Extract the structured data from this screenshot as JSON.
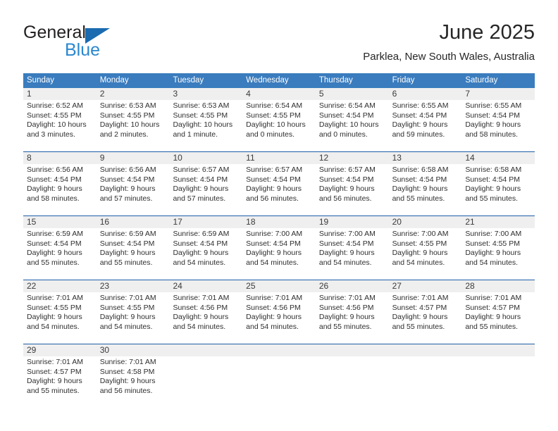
{
  "brand": {
    "name_primary": "General",
    "name_secondary": "Blue",
    "triangle_color": "#1a6bb0",
    "secondary_color": "#2a87d0"
  },
  "header": {
    "title": "June 2025",
    "subtitle": "Parklea, New South Wales, Australia"
  },
  "theme": {
    "header_row_bg": "#3a7cbe",
    "week_separator": "#1f5fa8",
    "daynum_band_bg": "#efefef",
    "text_color": "#2e2e2e"
  },
  "calendar": {
    "day_headers": [
      "Sunday",
      "Monday",
      "Tuesday",
      "Wednesday",
      "Thursday",
      "Friday",
      "Saturday"
    ],
    "weeks": [
      [
        {
          "day": "1",
          "lines": [
            "Sunrise: 6:52 AM",
            "Sunset: 4:55 PM",
            "Daylight: 10 hours",
            "and 3 minutes."
          ]
        },
        {
          "day": "2",
          "lines": [
            "Sunrise: 6:53 AM",
            "Sunset: 4:55 PM",
            "Daylight: 10 hours",
            "and 2 minutes."
          ]
        },
        {
          "day": "3",
          "lines": [
            "Sunrise: 6:53 AM",
            "Sunset: 4:55 PM",
            "Daylight: 10 hours",
            "and 1 minute."
          ]
        },
        {
          "day": "4",
          "lines": [
            "Sunrise: 6:54 AM",
            "Sunset: 4:55 PM",
            "Daylight: 10 hours",
            "and 0 minutes."
          ]
        },
        {
          "day": "5",
          "lines": [
            "Sunrise: 6:54 AM",
            "Sunset: 4:54 PM",
            "Daylight: 10 hours",
            "and 0 minutes."
          ]
        },
        {
          "day": "6",
          "lines": [
            "Sunrise: 6:55 AM",
            "Sunset: 4:54 PM",
            "Daylight: 9 hours",
            "and 59 minutes."
          ]
        },
        {
          "day": "7",
          "lines": [
            "Sunrise: 6:55 AM",
            "Sunset: 4:54 PM",
            "Daylight: 9 hours",
            "and 58 minutes."
          ]
        }
      ],
      [
        {
          "day": "8",
          "lines": [
            "Sunrise: 6:56 AM",
            "Sunset: 4:54 PM",
            "Daylight: 9 hours",
            "and 58 minutes."
          ]
        },
        {
          "day": "9",
          "lines": [
            "Sunrise: 6:56 AM",
            "Sunset: 4:54 PM",
            "Daylight: 9 hours",
            "and 57 minutes."
          ]
        },
        {
          "day": "10",
          "lines": [
            "Sunrise: 6:57 AM",
            "Sunset: 4:54 PM",
            "Daylight: 9 hours",
            "and 57 minutes."
          ]
        },
        {
          "day": "11",
          "lines": [
            "Sunrise: 6:57 AM",
            "Sunset: 4:54 PM",
            "Daylight: 9 hours",
            "and 56 minutes."
          ]
        },
        {
          "day": "12",
          "lines": [
            "Sunrise: 6:57 AM",
            "Sunset: 4:54 PM",
            "Daylight: 9 hours",
            "and 56 minutes."
          ]
        },
        {
          "day": "13",
          "lines": [
            "Sunrise: 6:58 AM",
            "Sunset: 4:54 PM",
            "Daylight: 9 hours",
            "and 55 minutes."
          ]
        },
        {
          "day": "14",
          "lines": [
            "Sunrise: 6:58 AM",
            "Sunset: 4:54 PM",
            "Daylight: 9 hours",
            "and 55 minutes."
          ]
        }
      ],
      [
        {
          "day": "15",
          "lines": [
            "Sunrise: 6:59 AM",
            "Sunset: 4:54 PM",
            "Daylight: 9 hours",
            "and 55 minutes."
          ]
        },
        {
          "day": "16",
          "lines": [
            "Sunrise: 6:59 AM",
            "Sunset: 4:54 PM",
            "Daylight: 9 hours",
            "and 55 minutes."
          ]
        },
        {
          "day": "17",
          "lines": [
            "Sunrise: 6:59 AM",
            "Sunset: 4:54 PM",
            "Daylight: 9 hours",
            "and 54 minutes."
          ]
        },
        {
          "day": "18",
          "lines": [
            "Sunrise: 7:00 AM",
            "Sunset: 4:54 PM",
            "Daylight: 9 hours",
            "and 54 minutes."
          ]
        },
        {
          "day": "19",
          "lines": [
            "Sunrise: 7:00 AM",
            "Sunset: 4:54 PM",
            "Daylight: 9 hours",
            "and 54 minutes."
          ]
        },
        {
          "day": "20",
          "lines": [
            "Sunrise: 7:00 AM",
            "Sunset: 4:55 PM",
            "Daylight: 9 hours",
            "and 54 minutes."
          ]
        },
        {
          "day": "21",
          "lines": [
            "Sunrise: 7:00 AM",
            "Sunset: 4:55 PM",
            "Daylight: 9 hours",
            "and 54 minutes."
          ]
        }
      ],
      [
        {
          "day": "22",
          "lines": [
            "Sunrise: 7:01 AM",
            "Sunset: 4:55 PM",
            "Daylight: 9 hours",
            "and 54 minutes."
          ]
        },
        {
          "day": "23",
          "lines": [
            "Sunrise: 7:01 AM",
            "Sunset: 4:55 PM",
            "Daylight: 9 hours",
            "and 54 minutes."
          ]
        },
        {
          "day": "24",
          "lines": [
            "Sunrise: 7:01 AM",
            "Sunset: 4:56 PM",
            "Daylight: 9 hours",
            "and 54 minutes."
          ]
        },
        {
          "day": "25",
          "lines": [
            "Sunrise: 7:01 AM",
            "Sunset: 4:56 PM",
            "Daylight: 9 hours",
            "and 54 minutes."
          ]
        },
        {
          "day": "26",
          "lines": [
            "Sunrise: 7:01 AM",
            "Sunset: 4:56 PM",
            "Daylight: 9 hours",
            "and 55 minutes."
          ]
        },
        {
          "day": "27",
          "lines": [
            "Sunrise: 7:01 AM",
            "Sunset: 4:57 PM",
            "Daylight: 9 hours",
            "and 55 minutes."
          ]
        },
        {
          "day": "28",
          "lines": [
            "Sunrise: 7:01 AM",
            "Sunset: 4:57 PM",
            "Daylight: 9 hours",
            "and 55 minutes."
          ]
        }
      ],
      [
        {
          "day": "29",
          "lines": [
            "Sunrise: 7:01 AM",
            "Sunset: 4:57 PM",
            "Daylight: 9 hours",
            "and 55 minutes."
          ]
        },
        {
          "day": "30",
          "lines": [
            "Sunrise: 7:01 AM",
            "Sunset: 4:58 PM",
            "Daylight: 9 hours",
            "and 56 minutes."
          ]
        },
        {
          "day": "",
          "lines": []
        },
        {
          "day": "",
          "lines": []
        },
        {
          "day": "",
          "lines": []
        },
        {
          "day": "",
          "lines": []
        },
        {
          "day": "",
          "lines": []
        }
      ]
    ]
  }
}
